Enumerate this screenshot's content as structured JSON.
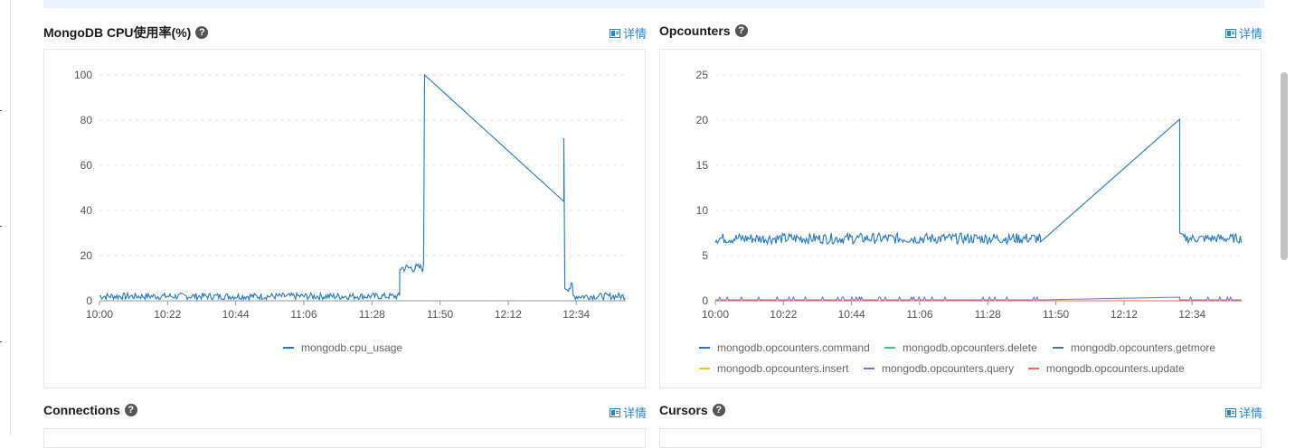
{
  "panels": [
    {
      "title": "MongoDB CPU使用率(%)",
      "detail_label": "详情",
      "chart_data": {
        "type": "line",
        "x": [
          "10:00",
          "10:22",
          "10:44",
          "11:06",
          "11:28",
          "11:50",
          "12:12",
          "12:34"
        ],
        "ylim": [
          0,
          100
        ],
        "yticks": [
          0,
          20,
          40,
          60,
          80,
          100
        ],
        "grid": true,
        "legend_position": "bottom",
        "series": [
          {
            "name": "mongodb.cpu_usage",
            "color": "#1f78c8",
            "segments": [
              {
                "from_min": 0,
                "to_min": 97,
                "base": 2.0,
                "noise": 1.5
              },
              {
                "from_min": 97,
                "to_min": 105,
                "base": 14.5,
                "noise": 2.0
              },
              {
                "from_min": 105,
                "to_min": 105.5,
                "value": 100
              },
              {
                "from_min": 105.5,
                "to_min": 150,
                "line_to": 44
              },
              {
                "from_min": 150,
                "to_min": 150.3,
                "value": 72
              },
              {
                "from_min": 150.3,
                "to_min": 153,
                "base": 6.0,
                "noise": 2.0
              },
              {
                "from_min": 153,
                "to_min": 170,
                "base": 2.0,
                "noise": 1.5
              }
            ]
          }
        ]
      }
    },
    {
      "title": "Opcounters",
      "detail_label": "详情",
      "chart_data": {
        "type": "line",
        "x": [
          "10:00",
          "10:22",
          "10:44",
          "11:06",
          "11:28",
          "11:50",
          "12:12",
          "12:34"
        ],
        "ylim": [
          0,
          25
        ],
        "yticks": [
          0,
          5,
          10,
          15,
          20,
          25
        ],
        "grid": true,
        "legend_position": "bottom",
        "series": [
          {
            "name": "mongodb.opcounters.command",
            "color": "#1f78c8",
            "segments": [
              {
                "from_min": 0,
                "to_min": 105,
                "base": 6.9,
                "noise": 0.6
              },
              {
                "from_min": 105,
                "to_min": 150,
                "line_from": 6.5,
                "line_to": 20.1
              },
              {
                "from_min": 150,
                "to_min": 151,
                "value": 7.5
              },
              {
                "from_min": 151,
                "to_min": 170,
                "base": 6.9,
                "noise": 0.5
              }
            ]
          },
          {
            "name": "mongodb.opcounters.delete",
            "color": "#36c39b"
          },
          {
            "name": "mongodb.opcounters.getmore",
            "color": "#5470a8"
          },
          {
            "name": "mongodb.opcounters.insert",
            "color": "#f5c518"
          },
          {
            "name": "mongodb.opcounters.query",
            "color": "#8c6bd6",
            "segments": [
              {
                "from_min": 0,
                "to_min": 105,
                "base": 0.1,
                "spike": 0.4
              },
              {
                "from_min": 105,
                "to_min": 150,
                "line_from": 0.1,
                "line_to": 0.4
              },
              {
                "from_min": 150,
                "to_min": 170,
                "base": 0.1,
                "spike": 0.4
              }
            ]
          },
          {
            "name": "mongodb.opcounters.update",
            "color": "#ee6d4a",
            "constant": 0
          }
        ]
      }
    },
    {
      "title": "Connections",
      "detail_label": "详情"
    },
    {
      "title": "Cursors",
      "detail_label": "详情"
    }
  ],
  "help_glyph": "?"
}
